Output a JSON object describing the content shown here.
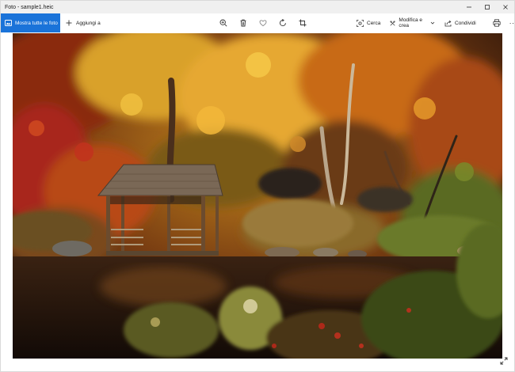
{
  "window": {
    "title": "Foto - sample1.heic",
    "controls": {
      "minimize": "minimize",
      "maximize": "maximize",
      "close": "close"
    }
  },
  "toolbar": {
    "show_all_label": "Mostra tutte le foto",
    "add_label": "Aggiungi a",
    "center_icons": [
      "zoom-in-icon",
      "delete-icon",
      "favorite-icon",
      "rotate-icon",
      "crop-icon"
    ],
    "search_label": "Cerca",
    "edit_label": "Modifica e crea",
    "share_label": "Condividi",
    "more_label": "···"
  },
  "photo": {
    "file_name": "sample1.heic",
    "subject": "wooden gazebo by autumn lake"
  },
  "colors": {
    "accent": "#1a73d9",
    "titlebar": "#f0f0f0",
    "text": "#1a1a1a",
    "icon": "#333333"
  }
}
